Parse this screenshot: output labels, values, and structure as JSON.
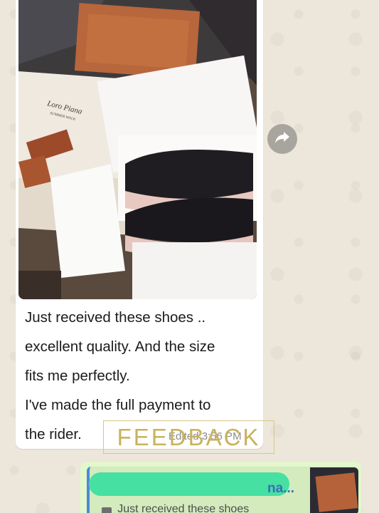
{
  "message": {
    "lines": [
      "Just received these shoes ..",
      "excellent quality. And the size",
      "fits me perfectly.",
      "I've made the full payment to",
      "the rider."
    ],
    "timestamp": "Edited 3:56 PM"
  },
  "photo": {
    "brand_text": "Loro Piana",
    "tissue_text": "SUMMER WALK"
  },
  "watermark": {
    "text": "FEEDBACK"
  },
  "reply": {
    "author_tail": "na...",
    "quote_text": "Just received these shoes"
  },
  "icons": {
    "forward": "forward-arrow-icon",
    "quote_photo": "camera-icon"
  },
  "colors": {
    "bubble": "#ffffff",
    "reply_bubble": "#e2f7cb",
    "quote_accent": "#4a88d8",
    "redaction": "#46e0a2",
    "watermark": "#c9b25a"
  }
}
